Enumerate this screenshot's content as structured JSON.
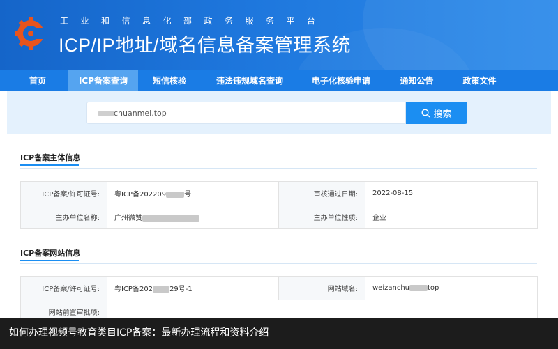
{
  "header": {
    "subtitle": "工业和信息化部政务服务平台",
    "title": "ICP/IP地址/域名信息备案管理系统"
  },
  "nav": {
    "items": [
      "首页",
      "ICP备案查询",
      "短信核验",
      "违法违规域名查询",
      "电子化核验申请",
      "通知公告",
      "政策文件"
    ],
    "active_index": 1
  },
  "search": {
    "value": "chuanmei.top",
    "button_label": "搜索"
  },
  "main_info": {
    "section_title": "ICP备案主体信息",
    "license_label": "ICP备案/许可证号:",
    "license_prefix": "粤ICP备202209",
    "license_suffix": "号",
    "approval_date_label": "审核通过日期:",
    "approval_date": "2022-08-15",
    "org_name_label": "主办单位名称:",
    "org_name_prefix": "广州微赞",
    "org_type_label": "主办单位性质:",
    "org_type": "企业"
  },
  "site_info": {
    "section_title": "ICP备案网站信息",
    "license_label": "ICP备案/许可证号:",
    "license_prefix": "粤ICP备202",
    "license_suffix": "29号-1",
    "domain_label": "网站域名:",
    "domain_prefix": "weizanchu",
    "domain_suffix": "top",
    "pre_approval_label": "网站前置审批项:"
  },
  "caption": "如何办理视频号教育类目ICP备案：最新办理流程和资料介绍",
  "colors": {
    "header_bg": "#1e77dd",
    "nav_bg": "#1a7ce5",
    "nav_active": "#55a4f0",
    "accent": "#1b8ef2",
    "logo": "#e8541c"
  }
}
